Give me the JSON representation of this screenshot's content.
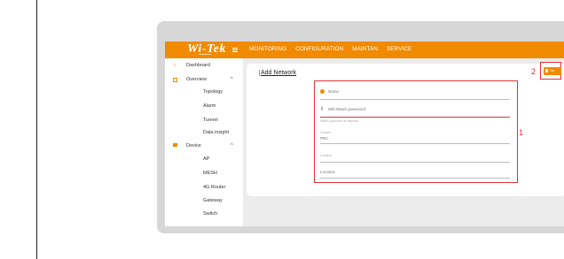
{
  "brand": {
    "logo": "Wi-Tek"
  },
  "nav": {
    "items": [
      "MONITORING",
      "CONFIGURATION",
      "MAINTAN",
      "SERVICE"
    ]
  },
  "sidebar": {
    "items": [
      {
        "label": "Dashboard",
        "icon": "home-icon"
      },
      {
        "label": "Overview",
        "icon": "overview-icon",
        "chevron": "^"
      },
      {
        "label": "Topology"
      },
      {
        "label": "Alarm"
      },
      {
        "label": "Tunnel"
      },
      {
        "label": "Data insight"
      },
      {
        "label": "Device",
        "icon": "device-icon",
        "chevron": "^"
      },
      {
        "label": "AP"
      },
      {
        "label": "MESH"
      },
      {
        "label": "4G Router"
      },
      {
        "label": "Gateway"
      },
      {
        "label": "Switch"
      }
    ]
  },
  "form": {
    "title": "Add Network",
    "name_placeholder": "Name",
    "password_placeholder": "Wifi-Watch password",
    "password_hint": "Watch password is required",
    "country_label": "Country",
    "country_value": "PRC",
    "second_label": "Location",
    "third_label": "Location"
  },
  "annotations": {
    "one": "1",
    "two": "2"
  },
  "action_button": {
    "label": "Sa"
  },
  "colors": {
    "accent": "#f08a00",
    "highlight": "#dd3333"
  }
}
